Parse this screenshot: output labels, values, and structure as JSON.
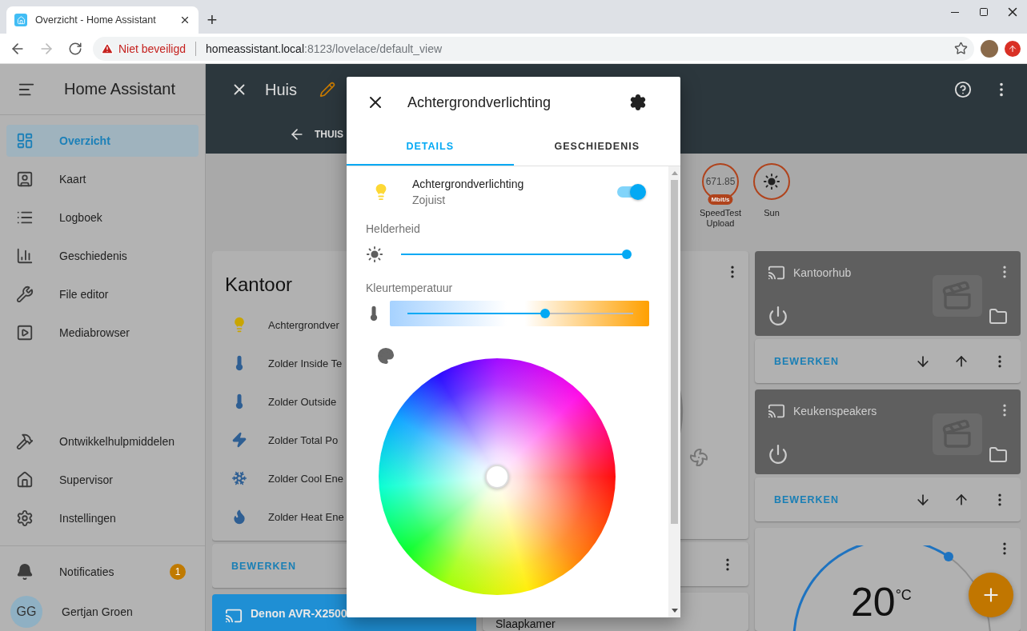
{
  "browser": {
    "tab_title": "Overzicht - Home Assistant",
    "new_tab": "+",
    "security": "Niet beveiligd",
    "url_host": "homeassistant.local",
    "url_path": ":8123/lovelace/default_view"
  },
  "sidebar": {
    "title": "Home Assistant",
    "items": [
      {
        "label": "Overzicht",
        "selected": true
      },
      {
        "label": "Kaart",
        "selected": false
      },
      {
        "label": "Logboek",
        "selected": false
      },
      {
        "label": "Geschiedenis",
        "selected": false
      },
      {
        "label": "File editor",
        "selected": false
      },
      {
        "label": "Mediabrowser",
        "selected": false
      }
    ],
    "tools": [
      {
        "label": "Ontwikkelhulpmiddelen",
        "selected": false
      },
      {
        "label": "Supervisor",
        "selected": false
      },
      {
        "label": "Instellingen",
        "selected": false
      }
    ],
    "notifications": {
      "label": "Notificaties",
      "count": "1"
    },
    "user": {
      "initials": "GG",
      "name": "Gertjan Groen"
    }
  },
  "header": {
    "title": "Huis",
    "tab": "THUIS"
  },
  "badges": [
    {
      "kind": "sensor",
      "value": "671.85",
      "unit": "Mbit/s",
      "label": "SpeedTest Upload"
    },
    {
      "kind": "sun",
      "label": "Sun"
    }
  ],
  "kantoor": {
    "title": "Kantoor",
    "rows": [
      "Achtergrondver",
      "Zolder Inside Te",
      "Zolder Outside",
      "Zolder Total Po",
      "Zolder Cool Ene",
      "Zolder Heat Ene"
    ],
    "action": "BEWERKEN"
  },
  "media_player": {
    "name": "Denon AVR-X2500"
  },
  "middle": {
    "title": "Slaapkamer"
  },
  "media_cards": [
    {
      "name": "Kantoorhub",
      "action": "BEWERKEN"
    },
    {
      "name": "Keukenspeakers",
      "action": "BEWERKEN"
    }
  ],
  "thermostat": {
    "temperature": "20",
    "unit": "°C"
  },
  "dialog": {
    "title": "Achtergrondverlichting",
    "tabs": [
      {
        "label": "DETAILS",
        "selected": true
      },
      {
        "label": "GESCHIEDENIS",
        "selected": false
      }
    ],
    "entity": {
      "name": "Achtergrondverlichting",
      "last_changed": "Zojuist",
      "on": true
    },
    "brightness": {
      "label": "Helderheid",
      "level": 1
    },
    "color_temp": {
      "label": "Kleurtemperatuur",
      "level": 0.61
    }
  }
}
